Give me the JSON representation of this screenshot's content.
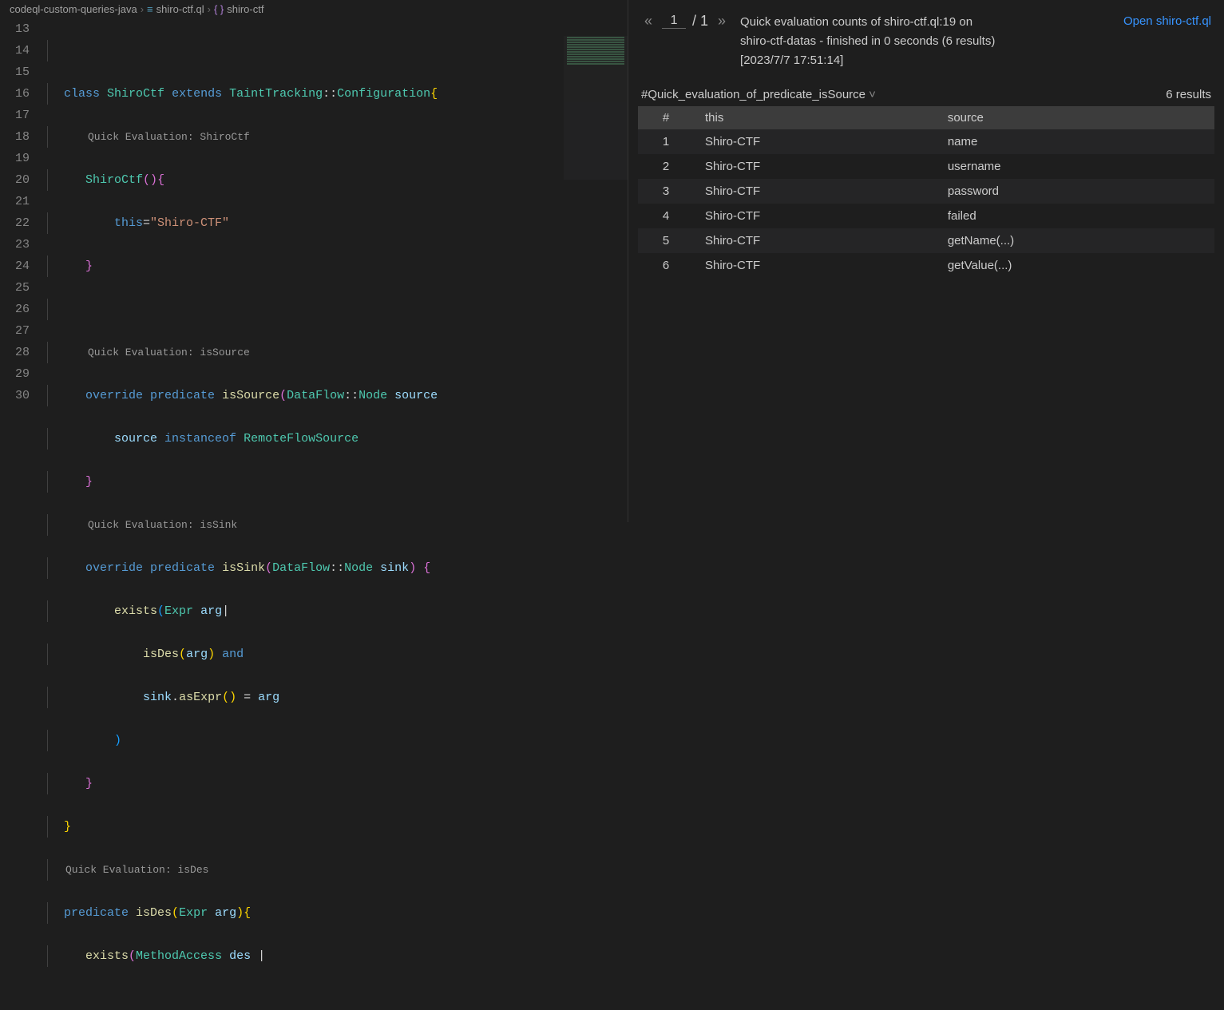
{
  "breadcrumb": {
    "folder": "codeql-custom-queries-java",
    "file": "shiro-ctf.ql",
    "symbol": "shiro-ctf"
  },
  "editor": {
    "lineNumbers": [
      "13",
      "14",
      "",
      "15",
      "16",
      "17",
      "18",
      "",
      "19",
      "20",
      "21",
      "",
      "22",
      "23",
      "24",
      "25",
      "26",
      "27",
      "28",
      "",
      "29",
      "30"
    ],
    "codelens": {
      "shiroctf": "Quick Evaluation: ShiroCtf",
      "isSource": "Quick Evaluation: isSource",
      "isSink": "Quick Evaluation: isSink",
      "isDes": "Quick Evaluation: isDes"
    },
    "tokens": {
      "class": "class",
      "extends": "extends",
      "override": "override",
      "predicate": "predicate",
      "instanceof": "instanceof",
      "and": "and",
      "exists": "exists",
      "this": "this",
      "ShiroCtf": "ShiroCtf",
      "TaintTracking": "TaintTracking",
      "Configuration": "Configuration",
      "isSource": "isSource",
      "isSink": "isSink",
      "isDes": "isDes",
      "DataFlow": "DataFlow",
      "Node": "Node",
      "Expr": "Expr",
      "MethodAccess": "MethodAccess",
      "RemoteFlowSource": "RemoteFlowSource",
      "source": "source",
      "sink": "sink",
      "arg": "arg",
      "des": "des",
      "asExpr": "asExpr",
      "strShiroCTF": "\"Shiro-CTF\""
    }
  },
  "results": {
    "pager": {
      "current": "1",
      "total": "/ 1"
    },
    "summaryLine1": "Quick evaluation counts of shiro-ctf.ql:19 on",
    "summaryLine2": "shiro-ctf-datas - finished in 0 seconds (6 results)",
    "summaryLine3": "[2023/7/7 17:51:14]",
    "openLink": "Open shiro-ctf.ql",
    "predicateLabel": "#Quick_evaluation_of_predicate_isSource",
    "countLabel": "6 results",
    "columns": {
      "idx": "#",
      "this": "this",
      "source": "source"
    },
    "rows": [
      {
        "idx": "1",
        "this": "Shiro-CTF",
        "source": "name"
      },
      {
        "idx": "2",
        "this": "Shiro-CTF",
        "source": "username"
      },
      {
        "idx": "3",
        "this": "Shiro-CTF",
        "source": "password"
      },
      {
        "idx": "4",
        "this": "Shiro-CTF",
        "source": "failed"
      },
      {
        "idx": "5",
        "this": "Shiro-CTF",
        "source": "getName(...)"
      },
      {
        "idx": "6",
        "this": "Shiro-CTF",
        "source": "getValue(...)"
      }
    ]
  }
}
